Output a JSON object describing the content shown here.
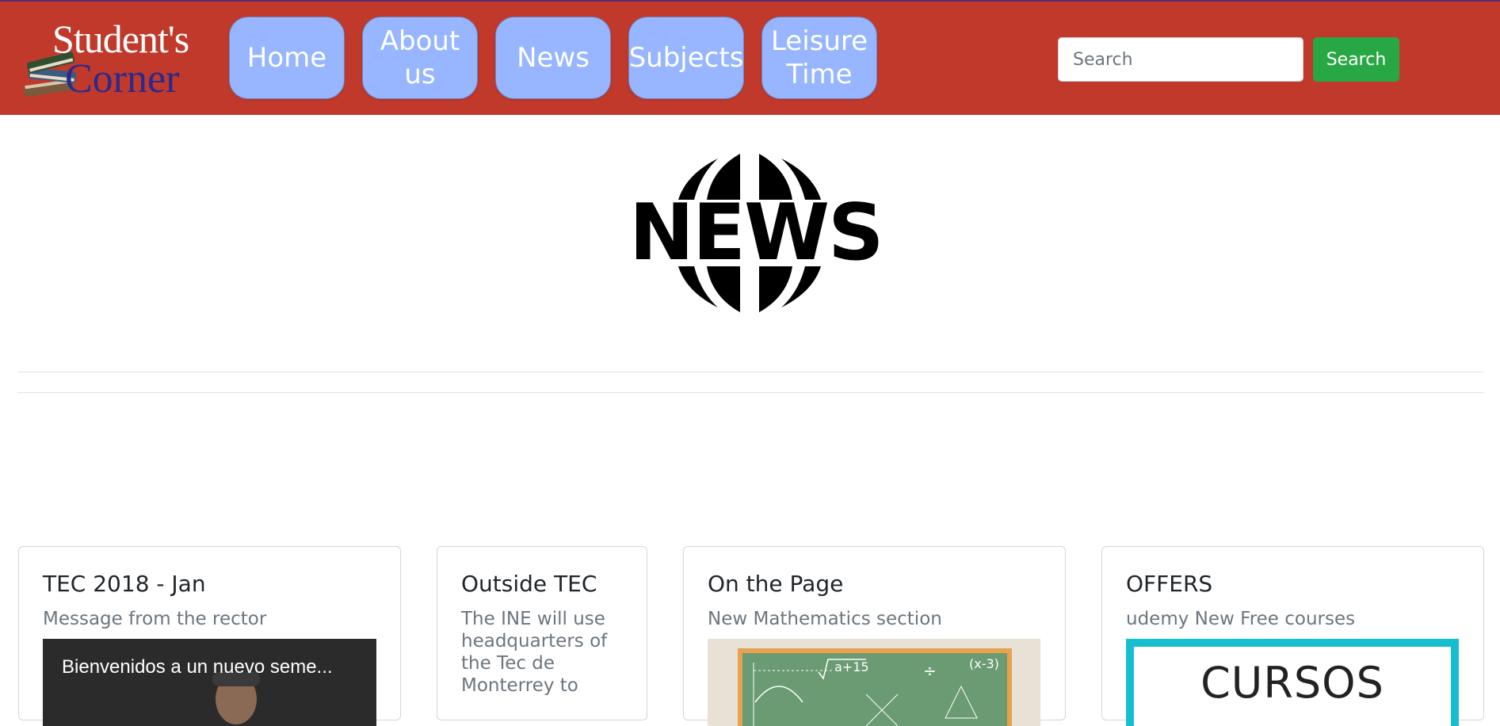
{
  "header": {
    "logo_line1": "Student's",
    "logo_line2": "Corner",
    "nav": [
      {
        "label": "Home"
      },
      {
        "label": "About us"
      },
      {
        "label": "News"
      },
      {
        "label": "Subjects"
      },
      {
        "label": "Leisure Time"
      }
    ],
    "search_placeholder": "Search",
    "search_button": "Search"
  },
  "hero": {
    "logo_text": "NEWS"
  },
  "cards": [
    {
      "title": "TEC 2018 - Jan",
      "subtitle": "Message from the rector",
      "video_title": "Bienvenidos a un nuevo seme..."
    },
    {
      "title": "Outside TEC",
      "subtitle_lines": [
        "The INE will use",
        "headquarters of",
        "the Tec de",
        "Monterrey to"
      ]
    },
    {
      "title": "On the Page",
      "subtitle": "New Mathematics section",
      "board_formula_1": "a+15",
      "board_formula_2": "(x-3)",
      "board_op": "÷"
    },
    {
      "title": "OFFERS",
      "subtitle": "udemy New Free courses",
      "image_text": "CURSOS"
    }
  ],
  "colors": {
    "header_bg": "#c0392b",
    "nav_bg": "#97b6ff",
    "search_button": "#28a745",
    "offer_border": "#17becf"
  }
}
